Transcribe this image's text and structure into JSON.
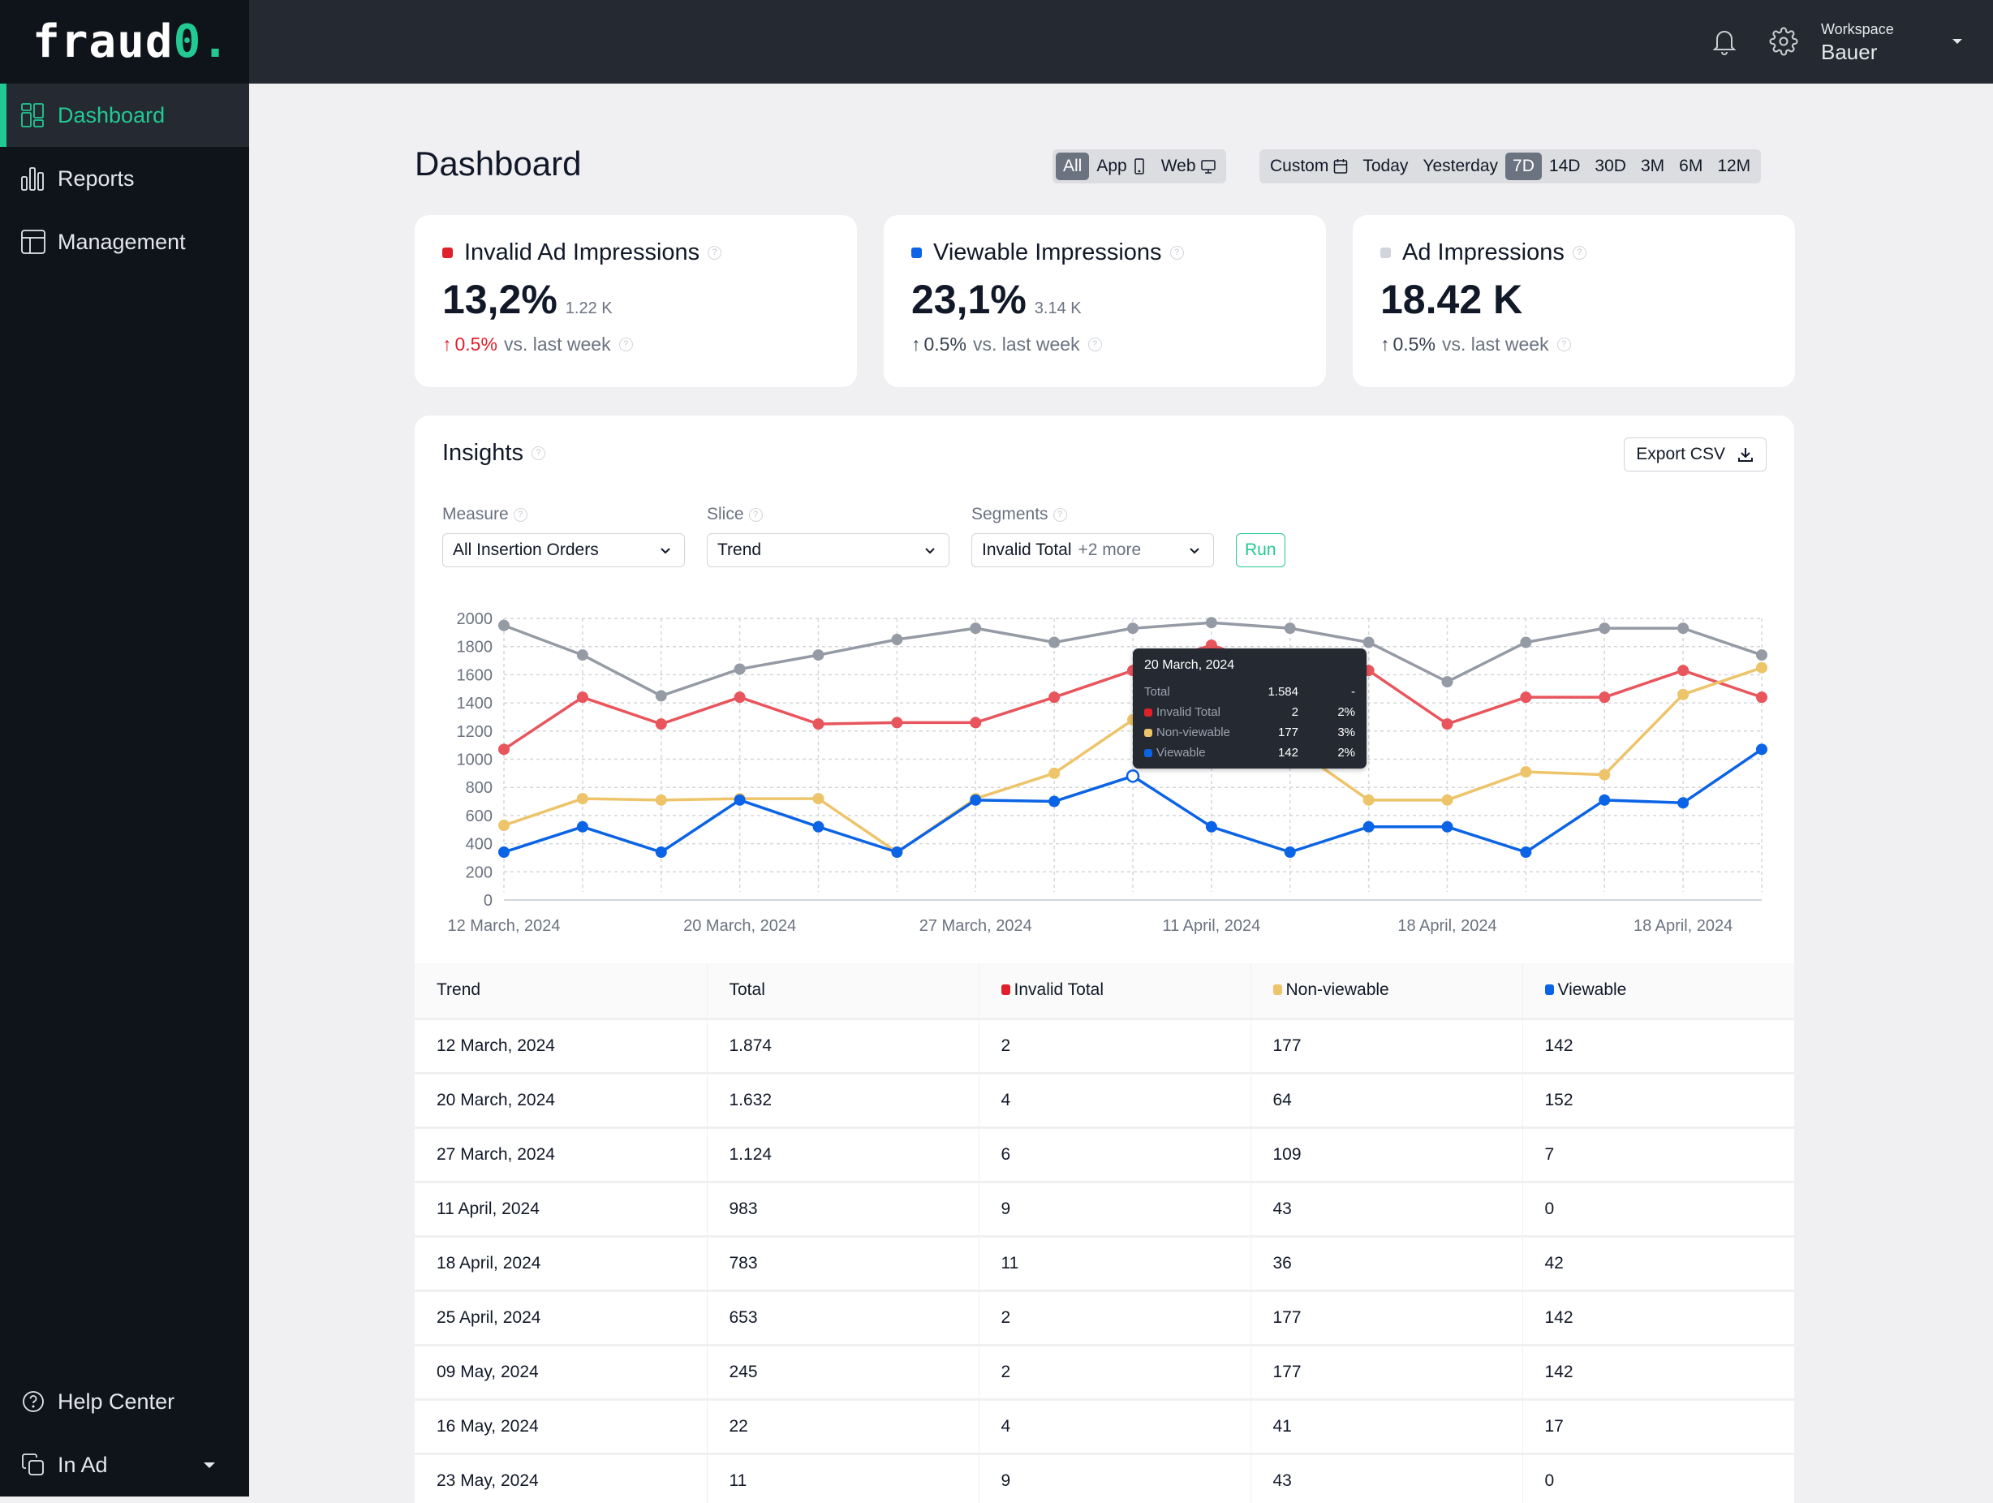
{
  "brand": {
    "name_main": "fraud",
    "name_accent": "0",
    "name_dot": "."
  },
  "sidebar": {
    "items": [
      {
        "label": "Dashboard",
        "icon": "dashboard-icon",
        "active": true
      },
      {
        "label": "Reports",
        "icon": "bar-chart-icon",
        "active": false
      },
      {
        "label": "Management",
        "icon": "layout-icon",
        "active": false
      }
    ],
    "bottom": [
      {
        "label": "Help Center",
        "icon": "help-circle-icon"
      },
      {
        "label": "In Ad",
        "icon": "copy-icon"
      }
    ]
  },
  "topbar": {
    "workspace_label": "Workspace",
    "workspace_value": "Bauer"
  },
  "page": {
    "title": "Dashboard"
  },
  "platform_filter": [
    {
      "label": "All",
      "selected": true
    },
    {
      "label": "App",
      "icon": "mobile-icon",
      "selected": false
    },
    {
      "label": "Web",
      "icon": "monitor-icon",
      "selected": false
    }
  ],
  "range_filter": [
    {
      "label": "Custom",
      "icon": "calendar-icon",
      "selected": false
    },
    {
      "label": "Today",
      "selected": false
    },
    {
      "label": "Yesterday",
      "selected": false
    },
    {
      "label": "7D",
      "selected": true
    },
    {
      "label": "14D",
      "selected": false
    },
    {
      "label": "30D",
      "selected": false
    },
    {
      "label": "3M",
      "selected": false
    },
    {
      "label": "6M",
      "selected": false
    },
    {
      "label": "12M",
      "selected": false
    }
  ],
  "kpis": [
    {
      "title": "Invalid Ad Impressions",
      "color": "#e0202b",
      "value": "13,2%",
      "sub": "1.22 K",
      "delta": "0.5%",
      "delta_color": "#e0202b",
      "vs": "vs. last week"
    },
    {
      "title": "Viewable Impressions",
      "color": "#0b63e5",
      "value": "23,1%",
      "sub": "3.14 K",
      "delta": "0.5%",
      "delta_color": "#374151",
      "vs": "vs. last week"
    },
    {
      "title": "Ad Impressions",
      "color": "#d1d5db",
      "value": "18.42 K",
      "sub": "",
      "delta": "0.5%",
      "delta_color": "#374151",
      "vs": "vs. last week"
    }
  ],
  "insights": {
    "title": "Insights",
    "export_label": "Export CSV",
    "measure_label": "Measure",
    "measure_value": "All Insertion Orders",
    "slice_label": "Slice",
    "slice_value": "Trend",
    "segments_label": "Segments",
    "segments_value": "Invalid Total",
    "segments_more": "+2 more",
    "run_label": "Run"
  },
  "tooltip": {
    "title": "20 March, 2024",
    "rows": [
      {
        "name": "Total",
        "value": "1.584",
        "pct": "-",
        "color": ""
      },
      {
        "name": "Invalid Total",
        "value": "2",
        "pct": "2%",
        "color": "#e0202b"
      },
      {
        "name": "Non-viewable",
        "value": "177",
        "pct": "3%",
        "color": "#edc46a"
      },
      {
        "name": "Viewable",
        "value": "142",
        "pct": "2%",
        "color": "#0b63e5"
      }
    ]
  },
  "chart_data": {
    "type": "line",
    "title": "",
    "xlabel": "",
    "ylabel": "",
    "ylim": [
      0,
      2000
    ],
    "yticks": [
      0,
      200,
      400,
      600,
      800,
      1000,
      1200,
      1400,
      1600,
      1800,
      2000
    ],
    "grid": true,
    "x_tick_labels": [
      "12 March, 2024",
      "20 March, 2024",
      "27 March, 2024",
      "11 April, 2024",
      "18 April, 2024",
      "18 April, 2024"
    ],
    "x_tick_positions": [
      0,
      3,
      6,
      9,
      12,
      15
    ],
    "point_count": 17,
    "series": [
      {
        "name": "Total",
        "color": "#959ba5",
        "values": [
          1950,
          1740,
          1450,
          1640,
          1740,
          1850,
          1930,
          1830,
          1930,
          1970,
          1930,
          1830,
          1550,
          1830,
          1930,
          1930,
          1740
        ]
      },
      {
        "name": "Invalid Total",
        "color": "#e8555d",
        "values": [
          1070,
          1440,
          1250,
          1440,
          1250,
          1260,
          1260,
          1440,
          1630,
          1810,
          1620,
          1630,
          1250,
          1440,
          1440,
          1630,
          1440
        ]
      },
      {
        "name": "Non-viewable",
        "color": "#edc46a",
        "values": [
          530,
          720,
          710,
          720,
          720,
          340,
          720,
          900,
          1280,
          1560,
          1100,
          710,
          710,
          910,
          890,
          1460,
          1650
        ]
      },
      {
        "name": "Viewable",
        "color": "#0b63e5",
        "values": [
          340,
          520,
          340,
          710,
          520,
          340,
          710,
          700,
          880,
          520,
          340,
          520,
          520,
          340,
          710,
          690,
          1070
        ]
      }
    ],
    "hover_index": 8
  },
  "table": {
    "columns": [
      {
        "label": "Trend",
        "color": ""
      },
      {
        "label": "Total",
        "color": ""
      },
      {
        "label": "Invalid Total",
        "color": "#e0202b"
      },
      {
        "label": "Non-viewable",
        "color": "#edc46a"
      },
      {
        "label": "Viewable",
        "color": "#0b63e5"
      }
    ],
    "rows": [
      [
        "12 March, 2024",
        "1.874",
        "2",
        "177",
        "142"
      ],
      [
        "20 March, 2024",
        "1.632",
        "4",
        "64",
        "152"
      ],
      [
        "27 March, 2024",
        "1.124",
        "6",
        "109",
        "7"
      ],
      [
        "11 April, 2024",
        "983",
        "9",
        "43",
        "0"
      ],
      [
        "18 April, 2024",
        "783",
        "11",
        "36",
        "42"
      ],
      [
        "25 April, 2024",
        "653",
        "2",
        "177",
        "142"
      ],
      [
        "09 May, 2024",
        "245",
        "2",
        "177",
        "142"
      ],
      [
        "16 May, 2024",
        "22",
        "4",
        "41",
        "17"
      ],
      [
        "23 May, 2024",
        "11",
        "9",
        "43",
        "0"
      ]
    ]
  }
}
